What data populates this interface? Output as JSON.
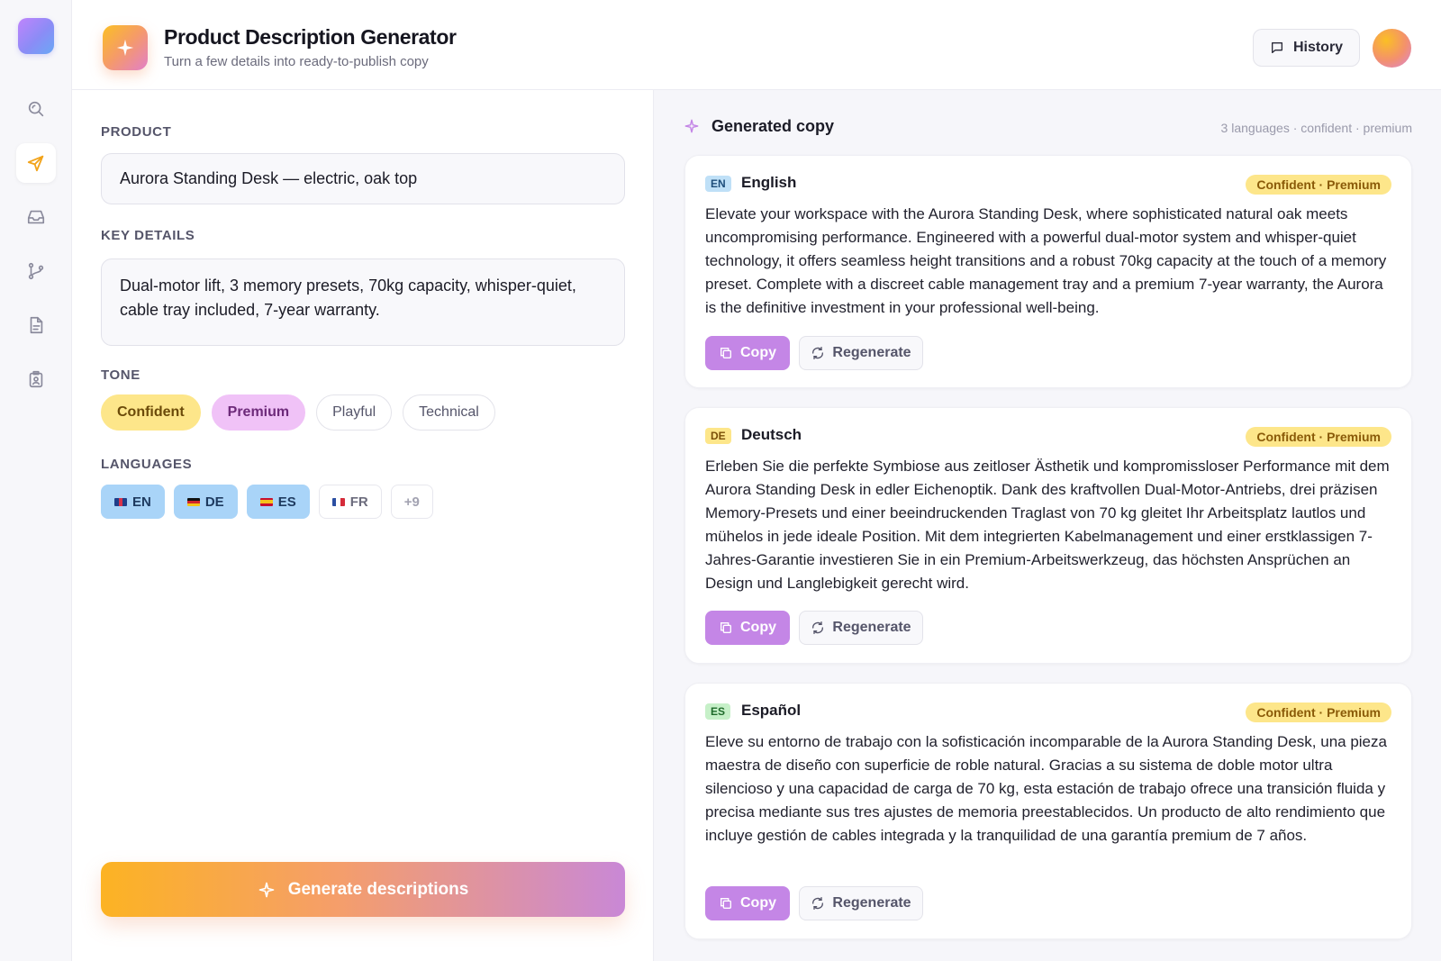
{
  "header": {
    "title": "Product Description Generator",
    "subtitle": "Turn a few details into ready-to-publish copy",
    "history_label": "History"
  },
  "sidebar": {
    "items": [
      {
        "name": "search",
        "icon": "search-icon"
      },
      {
        "name": "send",
        "icon": "send-icon",
        "active": true
      },
      {
        "name": "inbox",
        "icon": "inbox-icon"
      },
      {
        "name": "flow",
        "icon": "branch-icon"
      },
      {
        "name": "document",
        "icon": "document-icon"
      },
      {
        "name": "profile",
        "icon": "badge-icon"
      }
    ]
  },
  "form": {
    "product_label": "PRODUCT",
    "product_value": "Aurora Standing Desk — electric, oak top",
    "details_label": "KEY DETAILS",
    "details_value": "Dual-motor lift, 3 memory presets, 70kg capacity, whisper-quiet, cable tray included, 7-year warranty.",
    "tone_label": "TONE",
    "tones": [
      {
        "label": "Confident",
        "selected": true
      },
      {
        "label": "Premium",
        "selected": true
      },
      {
        "label": "Playful",
        "selected": false
      },
      {
        "label": "Technical",
        "selected": false
      }
    ],
    "languages_label": "LANGUAGES",
    "languages": [
      {
        "code": "EN",
        "selected": true
      },
      {
        "code": "DE",
        "selected": true
      },
      {
        "code": "ES",
        "selected": true
      },
      {
        "code": "FR",
        "selected": false
      }
    ],
    "more_languages": "+9",
    "generate_label": "Generate descriptions"
  },
  "output": {
    "title": "Generated copy",
    "meta": "3 languages · confident · premium",
    "cards": [
      {
        "code": "EN",
        "language": "English",
        "badge": "Confident · Premium",
        "text": "Elevate your workspace with the Aurora Standing Desk, where sophisticated natural oak meets uncompromising performance. Engineered with a powerful dual-motor system and whisper-quiet technology, it offers seamless height transitions and a robust 70kg capacity at the touch of a memory preset. Complete with a discreet cable management tray and a premium 7-year warranty, the Aurora is the definitive investment in your professional well-being.",
        "copy_label": "Copy",
        "regenerate_label": "Regenerate"
      },
      {
        "code": "DE",
        "language": "Deutsch",
        "badge": "Confident · Premium",
        "text": "Erleben Sie die perfekte Symbiose aus zeitloser Ästhetik und kompromissloser Performance mit dem Aurora Standing Desk in edler Eichenoptik. Dank des kraftvollen Dual-Motor-Antriebs, drei präzisen Memory-Presets und einer beeindruckenden Traglast von 70 kg gleitet Ihr Arbeitsplatz lautlos und mühelos in jede ideale Position. Mit dem integrierten Kabelmanagement und einer erstklassigen 7-Jahres-Garantie investieren Sie in ein Premium-Arbeitswerkzeug, das höchsten Ansprüchen an Design und Langlebigkeit gerecht wird.",
        "copy_label": "Copy",
        "regenerate_label": "Regenerate"
      },
      {
        "code": "ES",
        "language": "Español",
        "badge": "Confident · Premium",
        "text": "Eleve su entorno de trabajo con la sofisticación incomparable de la Aurora Standing Desk, una pieza maestra de diseño con superficie de roble natural. Gracias a su sistema de doble motor ultra silencioso y una capacidad de carga de 70 kg, esta estación de trabajo ofrece una transición fluida y precisa mediante sus tres ajustes de memoria preestablecidos. Un producto de alto rendimiento que incluye gestión de cables integrada y la tranquilidad de una garantía premium de 7 años.",
        "copy_label": "Copy",
        "regenerate_label": "Regenerate"
      }
    ]
  },
  "colors": {
    "accent_purple": "#c486e6",
    "accent_yellow": "#fde68a",
    "lang_selected": "#a9d4f8"
  }
}
